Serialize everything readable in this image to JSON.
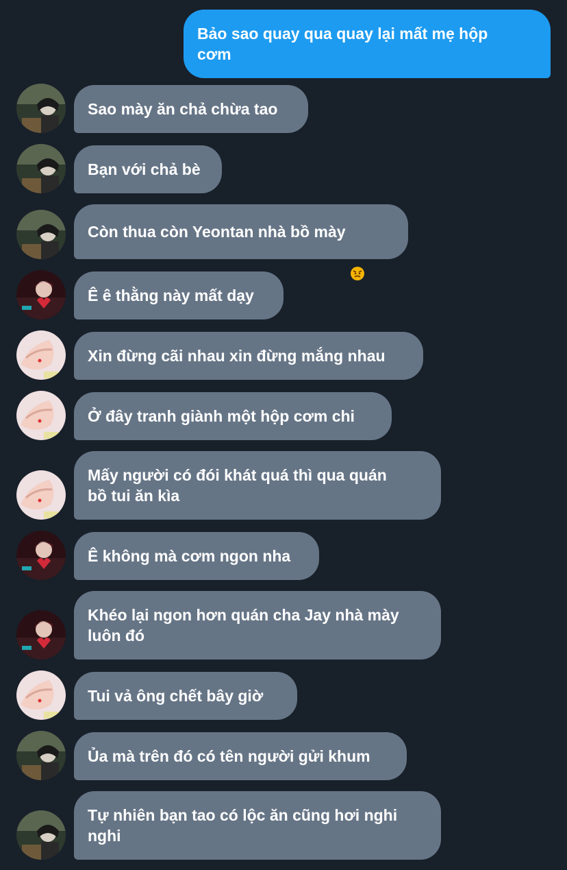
{
  "conversation": {
    "sent": [
      {
        "text": "Bảo sao quay qua quay lại mất mẹ hộp\ncơm"
      }
    ],
    "received": [
      {
        "text": "Sao mày ăn chả chừa tao",
        "sender_avatar": "avatar-a"
      },
      {
        "text": "Bạn với chả bè",
        "sender_avatar": "avatar-a"
      },
      {
        "text": "Còn thua còn Yeontan nhà bồ mày",
        "emoji": "angry-face-icon",
        "sender_avatar": "avatar-a"
      },
      {
        "text": "Ê ê thằng này mất dạy",
        "sender_avatar": "avatar-b"
      },
      {
        "text": "Xin đừng cãi nhau xin đừng mắng nhau",
        "sender_avatar": "avatar-c"
      },
      {
        "text": "Ở đây tranh giành một hộp cơm chi",
        "sender_avatar": "avatar-c"
      },
      {
        "text": "Mấy người có đói khát quá thì qua quán\nbồ tui ăn kìa",
        "sender_avatar": "avatar-c"
      },
      {
        "text": "Ê không mà cơm ngon nha",
        "sender_avatar": "avatar-b"
      },
      {
        "text": "Khéo lại ngon hơn quán cha Jay nhà mày\nluôn đó",
        "sender_avatar": "avatar-b"
      },
      {
        "text": "Tui vả ông chết bây giờ",
        "sender_avatar": "avatar-c"
      },
      {
        "text": "Ủa mà trên đó có tên người gửi khum",
        "sender_avatar": "avatar-a"
      },
      {
        "text": "Tự nhiên bạn tao có lộc ăn cũng hơi nghi\nnghi",
        "sender_avatar": "avatar-a"
      }
    ]
  },
  "colors": {
    "background": "#18202a",
    "sent_bubble": "#1d9bf0",
    "received_bubble": "#667586",
    "text": "#ffffff"
  }
}
